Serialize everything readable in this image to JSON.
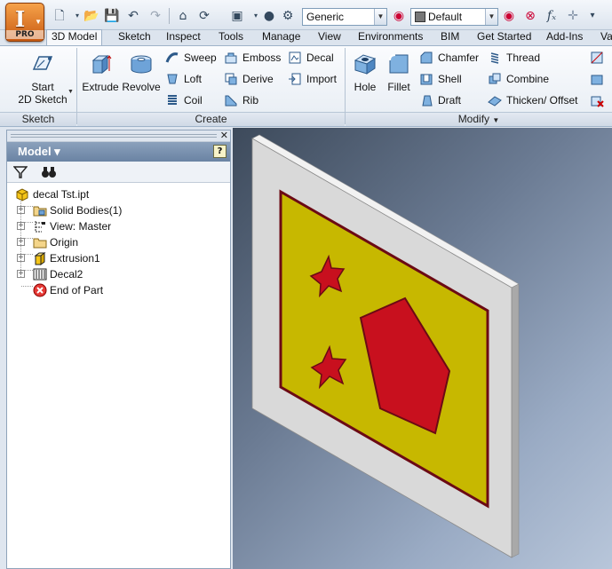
{
  "app": {
    "badge": "PRO",
    "logo_letter": "I"
  },
  "quick_access": {
    "material": "Generic",
    "appearance": "Default"
  },
  "tabs": [
    "3D Model",
    "Sketch",
    "Inspect",
    "Tools",
    "Manage",
    "View",
    "Environments",
    "BIM",
    "Get Started",
    "Add-Ins",
    "Va"
  ],
  "ribbon": {
    "panels": {
      "sketch": "Sketch",
      "create": "Create",
      "modify": "Modify"
    },
    "sketch": {
      "start_line1": "Start",
      "start_line2": "2D Sketch"
    },
    "create": {
      "extrude": "Extrude",
      "revolve": "Revolve",
      "sweep": "Sweep",
      "loft": "Loft",
      "coil": "Coil",
      "emboss": "Emboss",
      "derive": "Derive",
      "rib": "Rib",
      "decal": "Decal",
      "import": "Import"
    },
    "modify": {
      "hole": "Hole",
      "fillet": "Fillet",
      "chamfer": "Chamfer",
      "shell": "Shell",
      "draft": "Draft",
      "thread": "Thread",
      "combine": "Combine",
      "thicken_offset": "Thicken/ Offset"
    }
  },
  "browser": {
    "title": "Model",
    "tree": [
      {
        "label": "decal Tst.ipt",
        "icon": "part-icon"
      },
      {
        "label": "Solid Bodies(1)",
        "icon": "solid-bodies-icon"
      },
      {
        "label": "View: Master",
        "icon": "view-rep-icon"
      },
      {
        "label": "Origin",
        "icon": "folder-icon"
      },
      {
        "label": "Extrusion1",
        "icon": "extrusion-icon"
      },
      {
        "label": "Decal2",
        "icon": "decal-icon"
      },
      {
        "label": "End of Part",
        "icon": "end-of-part-icon"
      }
    ]
  },
  "colors": {
    "plate": "#d9d9d9",
    "decal_fill": "#c7b800",
    "shape_fill": "#c8101e",
    "outline": "#6b0a14"
  }
}
